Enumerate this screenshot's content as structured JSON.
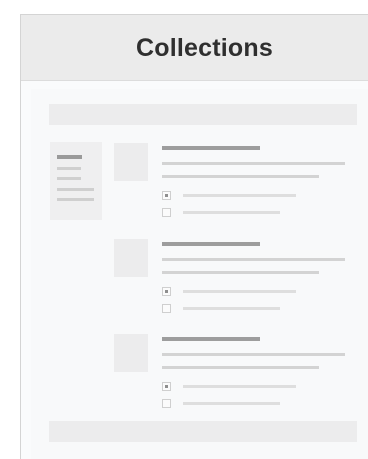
{
  "window": {
    "title": "Collections"
  },
  "colors": {
    "titlebar": "#ebebeb",
    "content_bg": "#f8f9fa",
    "placeholder": "#ececed",
    "skeleton_dark": "#9d9d9d",
    "skeleton_light": "#d3d3d3"
  },
  "items": [
    {
      "checkbox_1_checked": true,
      "checkbox_2_checked": false
    },
    {
      "checkbox_1_checked": true,
      "checkbox_2_checked": false
    },
    {
      "checkbox_1_checked": true,
      "checkbox_2_checked": false
    }
  ]
}
